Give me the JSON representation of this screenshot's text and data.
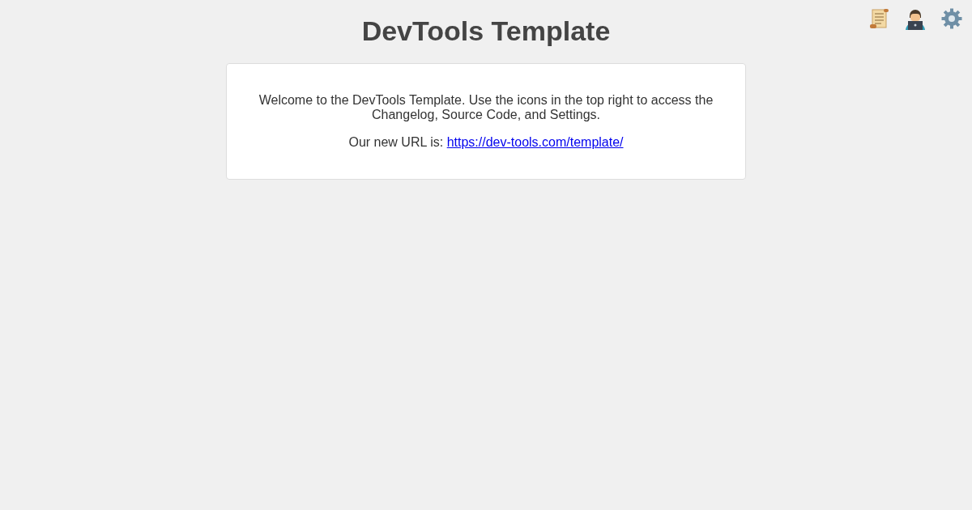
{
  "title": "DevTools Template",
  "toolbar": [
    {
      "kind": "changelog"
    },
    {
      "kind": "source"
    },
    {
      "kind": "settings"
    }
  ],
  "card": {
    "intro": "Welcome to the DevTools Template. Use the icons in the top right to access the Changelog, Source Code, and Settings.",
    "url_label": "Our new URL is:",
    "url": "https://dev-tools.com/template/"
  }
}
